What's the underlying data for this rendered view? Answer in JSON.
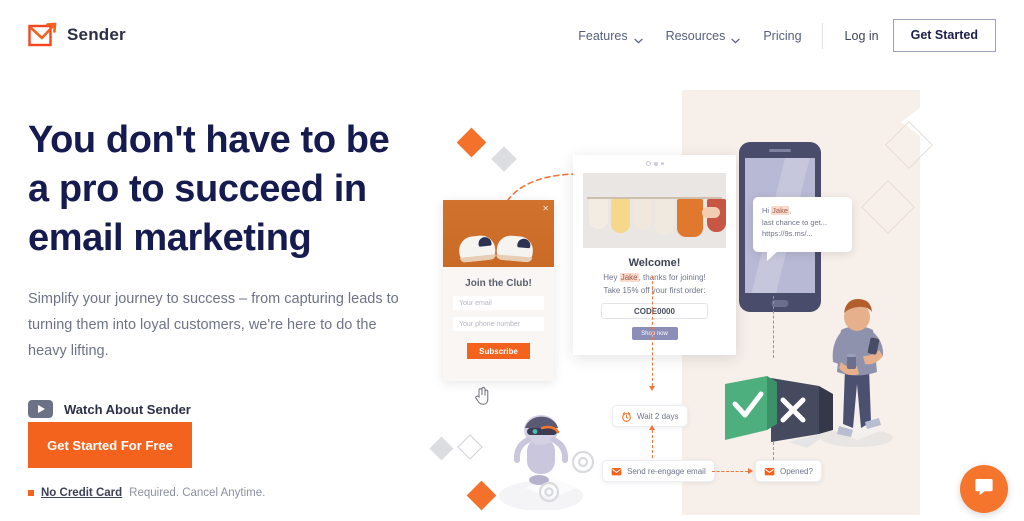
{
  "brand": {
    "name": "Sender",
    "logo_icon": "envelope-arrow-icon",
    "accent_color": "#f4631e"
  },
  "nav": {
    "items": [
      {
        "label": "Features",
        "has_dropdown": true,
        "icon": "chevron-down-icon"
      },
      {
        "label": "Resources",
        "has_dropdown": true,
        "icon": "chevron-down-icon"
      },
      {
        "label": "Pricing",
        "has_dropdown": false
      }
    ],
    "login_label": "Log in",
    "cta_label": "Get Started"
  },
  "hero": {
    "headline_line1": "You don't have to be",
    "headline_line2": "a pro to succeed in",
    "headline_line3": "email marketing",
    "subcopy": "Simplify your journey to success – from capturing leads to turning them into loyal customers, we're here to do the heavy lifting.",
    "watch_label": "Watch About Sender",
    "watch_icon": "play-icon",
    "cta_label": "Get Started For Free",
    "fineprint_strong": "No Credit Card",
    "fineprint_rest": "Required. Cancel Anytime.",
    "headline_color": "#151b4e"
  },
  "illustration": {
    "popup": {
      "title": "Join the Club!",
      "email_placeholder": "Your email",
      "phone_placeholder": "Your phone number",
      "subscribe_label": "Subscribe",
      "close_icon": "close-icon",
      "image_alt": "sneakers-photo"
    },
    "email_preview": {
      "title": "Welcome!",
      "line1_prefix": "Hey ",
      "line1_name": "Jake",
      "line1_suffix": ", thanks for joining!",
      "line2": "Take 15% off your first order:",
      "code": "CODE0000",
      "button_label": "Shop now",
      "image_alt": "clothing-rack-photo"
    },
    "sms": {
      "line1_prefix": "Hi ",
      "line1_name": "Jake",
      "line1_suffix": ",",
      "line2": "last chance to get...",
      "line3": "https://9s.ms/..."
    },
    "workflow": [
      {
        "label": "Wait 2 days",
        "icon": "alarm-clock-icon"
      },
      {
        "label": "Send re-engage email",
        "icon": "email-icon"
      },
      {
        "label": "Opened?",
        "icon": "email-icon"
      }
    ],
    "decision": {
      "yes_icon": "check-icon",
      "no_icon": "x-icon",
      "yes_color": "#4caf7d",
      "no_color": "#454a5e"
    },
    "figures": [
      {
        "name": "robot-figure"
      },
      {
        "name": "person-with-phone-figure"
      }
    ],
    "cursor_icon": "pointing-hand-icon"
  },
  "chat_widget": {
    "icon": "chat-bubble-icon",
    "color": "#f4752b"
  }
}
